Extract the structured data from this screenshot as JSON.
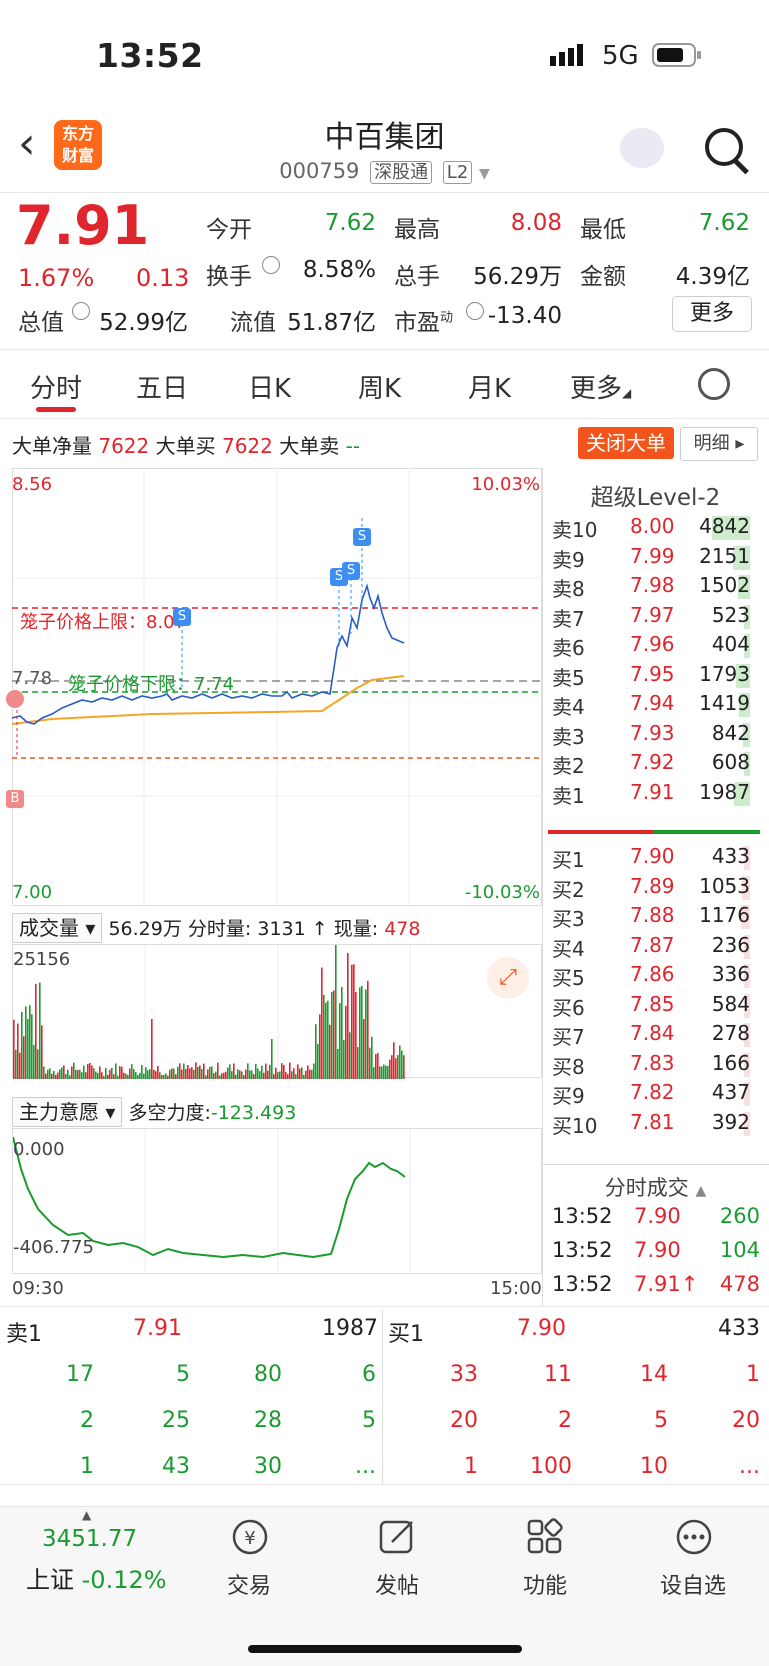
{
  "status_bar": {
    "time": "13:52",
    "network": "5G"
  },
  "header": {
    "logo_line1": "东方",
    "logo_line2": "财富",
    "name": "中百集团",
    "code": "000759",
    "tag1": "深股通",
    "tag2": "L2"
  },
  "quote": {
    "price": "7.91",
    "pct": "1.67%",
    "change": "0.13",
    "open_label": "今开",
    "open": "7.62",
    "high_label": "最高",
    "high": "8.08",
    "low_label": "最低",
    "low": "7.62",
    "turnover_label": "换手",
    "turnover": "8.58%",
    "volume_label": "总手",
    "volume": "56.29万",
    "amount_label": "金额",
    "amount": "4.39亿",
    "mktcap_label": "总值",
    "mktcap": "52.99亿",
    "float_label": "流值",
    "float": "51.87亿",
    "pe_label": "市盈",
    "pe_sup": "动",
    "pe": "-13.40",
    "more": "更多"
  },
  "tabs": [
    "分时",
    "五日",
    "日K",
    "周K",
    "月K",
    "更多"
  ],
  "big_order": {
    "net_label": "大单净量",
    "net": "7622",
    "buy_label": "大单买",
    "buy": "7622",
    "sell_label": "大单卖",
    "sell": "--",
    "close_btn": "关闭大单",
    "detail_btn": "明细"
  },
  "chart": {
    "y_top": "8.56",
    "y_bottom": "7.00",
    "pct_top": "10.03%",
    "pct_bottom": "-10.03%",
    "prev_close": "7.78",
    "upper_label": "笼子价格上限：8.07",
    "lower_label": "笼子价格下限：7.74",
    "marker_b": "B",
    "marker_s": "S"
  },
  "volume": {
    "select": "成交量",
    "total": "56.29万",
    "tick_label": "分时量:",
    "tick": "3131",
    "arrow": "↑",
    "now_label": "现量:",
    "now": "478",
    "max": "25156"
  },
  "main_force": {
    "select": "主力意愿",
    "label": "多空力度:",
    "value": "-123.493",
    "top": "0.000",
    "bottom": "-406.775",
    "time_start": "09:30",
    "time_end": "15:00"
  },
  "level2": {
    "title": "超级Level-2",
    "asks": [
      {
        "label": "卖10",
        "price": "8.00",
        "vol": "4842"
      },
      {
        "label": "卖9",
        "price": "7.99",
        "vol": "2151"
      },
      {
        "label": "卖8",
        "price": "7.98",
        "vol": "1502"
      },
      {
        "label": "卖7",
        "price": "7.97",
        "vol": "523"
      },
      {
        "label": "卖6",
        "price": "7.96",
        "vol": "404"
      },
      {
        "label": "卖5",
        "price": "7.95",
        "vol": "1793"
      },
      {
        "label": "卖4",
        "price": "7.94",
        "vol": "1419"
      },
      {
        "label": "卖3",
        "price": "7.93",
        "vol": "842"
      },
      {
        "label": "卖2",
        "price": "7.92",
        "vol": "608"
      },
      {
        "label": "卖1",
        "price": "7.91",
        "vol": "1987"
      }
    ],
    "bids": [
      {
        "label": "买1",
        "price": "7.90",
        "vol": "433"
      },
      {
        "label": "买2",
        "price": "7.89",
        "vol": "1053"
      },
      {
        "label": "买3",
        "price": "7.88",
        "vol": "1176"
      },
      {
        "label": "买4",
        "price": "7.87",
        "vol": "236"
      },
      {
        "label": "买5",
        "price": "7.86",
        "vol": "336"
      },
      {
        "label": "买6",
        "price": "7.85",
        "vol": "584"
      },
      {
        "label": "买7",
        "price": "7.84",
        "vol": "278"
      },
      {
        "label": "买8",
        "price": "7.83",
        "vol": "166"
      },
      {
        "label": "买9",
        "price": "7.82",
        "vol": "437"
      },
      {
        "label": "买10",
        "price": "7.81",
        "vol": "392"
      }
    ]
  },
  "ticks": {
    "title": "分时成交",
    "rows": [
      {
        "time": "13:52",
        "price": "7.90",
        "vol": "260"
      },
      {
        "time": "13:52",
        "price": "7.90",
        "vol": "104"
      },
      {
        "time": "13:52",
        "price": "7.91↑",
        "vol": "478"
      }
    ]
  },
  "queue": {
    "sell_label": "卖1",
    "sell_price": "7.91",
    "sell_vol": "1987",
    "buy_label": "买1",
    "buy_price": "7.90",
    "buy_vol": "433",
    "sell_rows": [
      [
        "17",
        "5",
        "80",
        "6"
      ],
      [
        "2",
        "25",
        "28",
        "5"
      ],
      [
        "1",
        "43",
        "30",
        "..."
      ]
    ],
    "buy_rows": [
      [
        "33",
        "11",
        "14",
        "1"
      ],
      [
        "20",
        "2",
        "5",
        "20"
      ],
      [
        "1",
        "100",
        "10",
        "..."
      ]
    ]
  },
  "bottom_nav": {
    "index_value": "3451.77",
    "index_name": "上证",
    "index_pct": "-0.12%",
    "trade": "交易",
    "post": "发帖",
    "func": "功能",
    "watch": "设自选"
  }
}
